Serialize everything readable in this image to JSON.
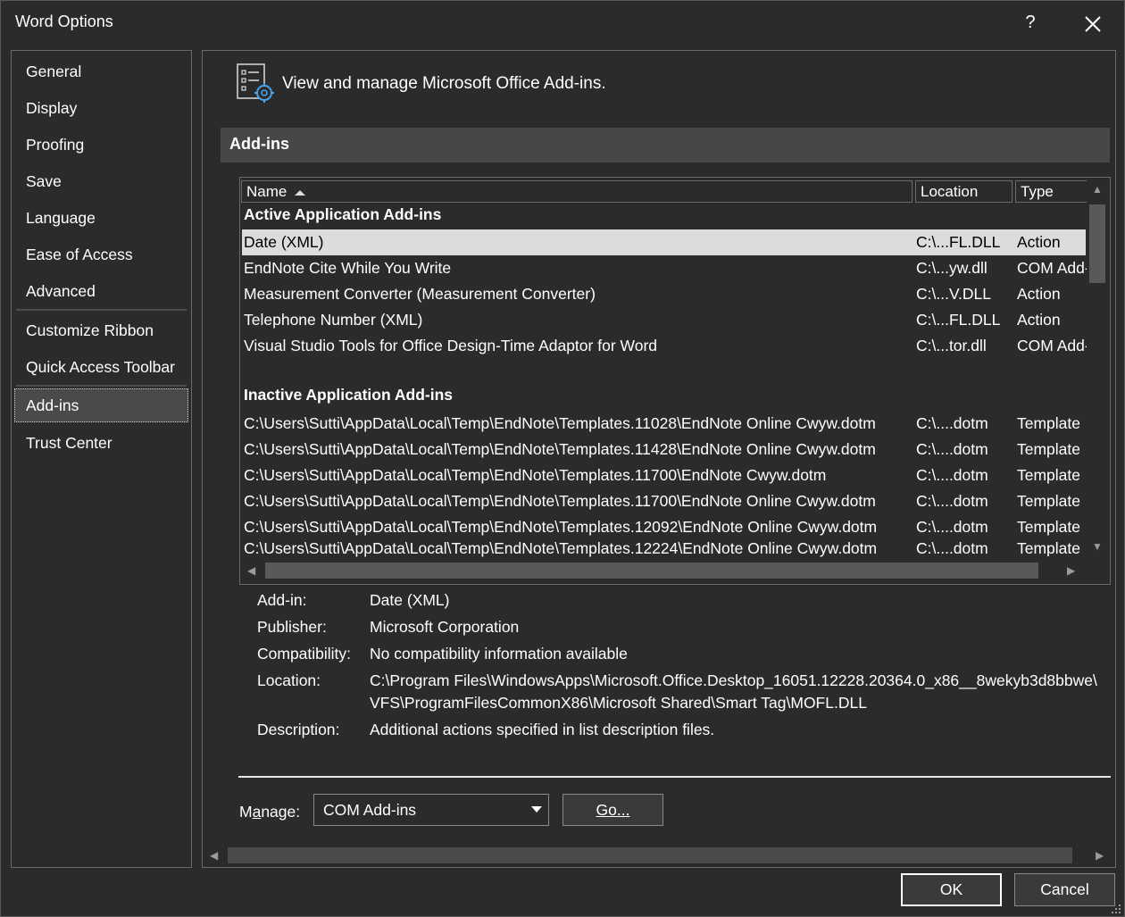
{
  "window": {
    "title": "Word Options",
    "help_label": "?",
    "close_icon": "close-icon"
  },
  "sidebar": {
    "items": [
      {
        "label": "General",
        "selected": false
      },
      {
        "label": "Display",
        "selected": false
      },
      {
        "label": "Proofing",
        "selected": false
      },
      {
        "label": "Save",
        "selected": false
      },
      {
        "label": "Language",
        "selected": false
      },
      {
        "label": "Ease of Access",
        "selected": false
      },
      {
        "label": "Advanced",
        "selected": false
      },
      {
        "label": "Customize Ribbon",
        "selected": false
      },
      {
        "label": "Quick Access Toolbar",
        "selected": false
      },
      {
        "label": "Add-ins",
        "selected": true
      },
      {
        "label": "Trust Center",
        "selected": false
      }
    ]
  },
  "main": {
    "header_text": "View and manage Microsoft Office Add-ins.",
    "section_title": "Add-ins",
    "columns": {
      "name": "Name",
      "location": "Location",
      "type": "Type"
    },
    "active_group_title": "Active Application Add-ins",
    "active_rows": [
      {
        "name": "Date (XML)",
        "location": "C:\\...FL.DLL",
        "type": "Action",
        "selected": true
      },
      {
        "name": "EndNote Cite While You Write",
        "location": "C:\\...yw.dll",
        "type": "COM Add-in"
      },
      {
        "name": "Measurement Converter (Measurement Converter)",
        "location": "C:\\...V.DLL",
        "type": "Action"
      },
      {
        "name": "Telephone Number (XML)",
        "location": "C:\\...FL.DLL",
        "type": "Action"
      },
      {
        "name": "Visual Studio Tools for Office Design-Time Adaptor for Word",
        "location": "C:\\...tor.dll",
        "type": "COM Add-in"
      }
    ],
    "inactive_group_title": "Inactive Application Add-ins",
    "inactive_rows": [
      {
        "name": "C:\\Users\\Sutti\\AppData\\Local\\Temp\\EndNote\\Templates.11028\\EndNote Online Cwyw.dotm",
        "location": "C:\\....dotm",
        "type": "Template"
      },
      {
        "name": "C:\\Users\\Sutti\\AppData\\Local\\Temp\\EndNote\\Templates.11428\\EndNote Online Cwyw.dotm",
        "location": "C:\\....dotm",
        "type": "Template"
      },
      {
        "name": "C:\\Users\\Sutti\\AppData\\Local\\Temp\\EndNote\\Templates.11700\\EndNote Cwyw.dotm",
        "location": "C:\\....dotm",
        "type": "Template"
      },
      {
        "name": "C:\\Users\\Sutti\\AppData\\Local\\Temp\\EndNote\\Templates.11700\\EndNote Online Cwyw.dotm",
        "location": "C:\\....dotm",
        "type": "Template"
      },
      {
        "name": "C:\\Users\\Sutti\\AppData\\Local\\Temp\\EndNote\\Templates.12092\\EndNote Online Cwyw.dotm",
        "location": "C:\\....dotm",
        "type": "Template"
      },
      {
        "name": "C:\\Users\\Sutti\\AppData\\Local\\Temp\\EndNote\\Templates.12224\\EndNote Online Cwyw.dotm",
        "location": "C:\\....dotm",
        "type": "Template"
      }
    ],
    "details": {
      "addin_label": "Add-in:",
      "addin_value": "Date (XML)",
      "publisher_label": "Publisher:",
      "publisher_value": "Microsoft Corporation",
      "compat_label": "Compatibility:",
      "compat_value": "No compatibility information available",
      "location_label": "Location:",
      "location_line1": "C:\\Program Files\\WindowsApps\\Microsoft.Office.Desktop_16051.12228.20364.0_x86__8wekyb3d8bbwe\\",
      "location_line2": "VFS\\ProgramFilesCommonX86\\Microsoft Shared\\Smart Tag\\MOFL.DLL",
      "description_label": "Description:",
      "description_value": "Additional actions specified in list description files."
    },
    "manage": {
      "label_prefix": "M",
      "label_ul": "a",
      "label_suffix": "nage:",
      "selected": "COM Add-ins",
      "go_label": "Go..."
    }
  },
  "footer": {
    "ok_label": "OK",
    "cancel_label": "Cancel"
  }
}
